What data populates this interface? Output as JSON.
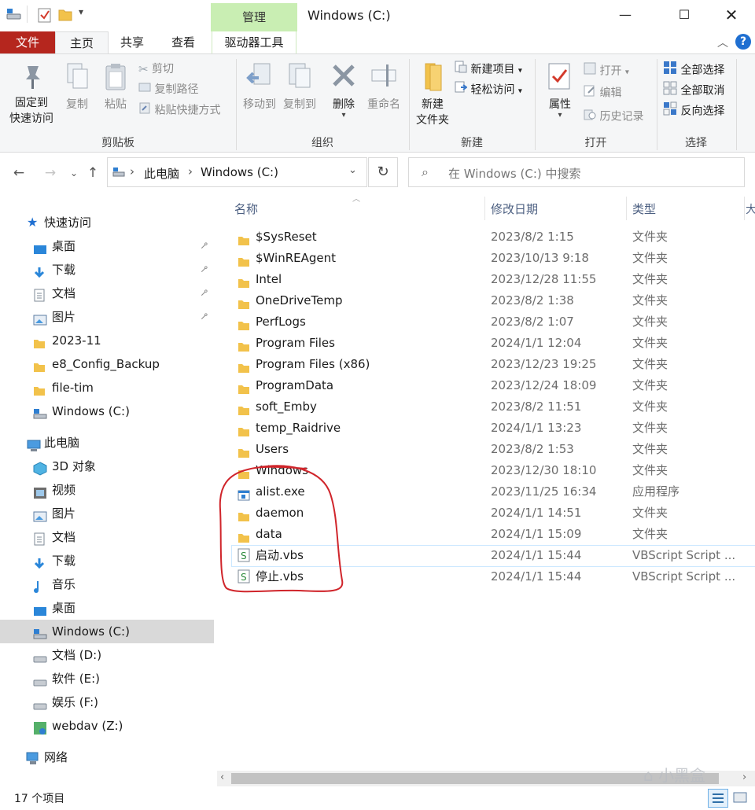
{
  "window": {
    "title": "Windows (C:)",
    "context_tab": "管理"
  },
  "tabs": [
    "文件",
    "主页",
    "共享",
    "查看",
    "驱动器工具"
  ],
  "ribbon": {
    "clipboard": {
      "pin": "固定到\n快速访问",
      "copy": "复制",
      "paste": "粘贴",
      "cut": "剪切",
      "copy_path": "复制路径",
      "paste_shortcut": "粘贴快捷方式",
      "label": "剪贴板"
    },
    "organize": {
      "move_to": "移动到",
      "copy_to": "复制到",
      "delete": "删除",
      "rename": "重命名",
      "label": "组织"
    },
    "new": {
      "new_folder": "新建\n文件夹",
      "new_item": "新建项目",
      "easy_access": "轻松访问",
      "label": "新建"
    },
    "open": {
      "properties": "属性",
      "open": "打开",
      "edit": "编辑",
      "history": "历史记录",
      "label": "打开"
    },
    "select": {
      "select_all": "全部选择",
      "select_none": "全部取消",
      "invert": "反向选择",
      "label": "选择"
    }
  },
  "address": {
    "crumbs": [
      "此电脑",
      "Windows (C:)"
    ],
    "search_placeholder": "在 Windows (C:) 中搜索"
  },
  "nav": {
    "quick_access": "快速访问",
    "quick_items": [
      {
        "label": "桌面",
        "pinned": true
      },
      {
        "label": "下载",
        "pinned": true
      },
      {
        "label": "文档",
        "pinned": true
      },
      {
        "label": "图片",
        "pinned": true
      },
      {
        "label": "2023-11",
        "pinned": false
      },
      {
        "label": "e8_Config_Backup",
        "pinned": false
      },
      {
        "label": "file-tim",
        "pinned": false
      },
      {
        "label": "Windows (C:)",
        "pinned": false
      }
    ],
    "this_pc": "此电脑",
    "pc_items": [
      "3D 对象",
      "视频",
      "图片",
      "文档",
      "下载",
      "音乐",
      "桌面",
      "Windows (C:)",
      "文档 (D:)",
      "软件 (E:)",
      "娱乐 (F:)",
      "webdav (Z:)"
    ],
    "network": "网络"
  },
  "columns": [
    "名称",
    "修改日期",
    "类型"
  ],
  "files": [
    {
      "name": "$SysReset",
      "date": "2023/8/2 1:15",
      "type": "文件夹",
      "icon": "folder"
    },
    {
      "name": "$WinREAgent",
      "date": "2023/10/13 9:18",
      "type": "文件夹",
      "icon": "folder"
    },
    {
      "name": "Intel",
      "date": "2023/12/28 11:55",
      "type": "文件夹",
      "icon": "folder"
    },
    {
      "name": "OneDriveTemp",
      "date": "2023/8/2 1:38",
      "type": "文件夹",
      "icon": "folder"
    },
    {
      "name": "PerfLogs",
      "date": "2023/8/2 1:07",
      "type": "文件夹",
      "icon": "folder"
    },
    {
      "name": "Program Files",
      "date": "2024/1/1 12:04",
      "type": "文件夹",
      "icon": "folder"
    },
    {
      "name": "Program Files (x86)",
      "date": "2023/12/23 19:25",
      "type": "文件夹",
      "icon": "folder"
    },
    {
      "name": "ProgramData",
      "date": "2023/12/24 18:09",
      "type": "文件夹",
      "icon": "folder"
    },
    {
      "name": "soft_Emby",
      "date": "2023/8/2 11:51",
      "type": "文件夹",
      "icon": "folder"
    },
    {
      "name": "temp_Raidrive",
      "date": "2024/1/1 13:23",
      "type": "文件夹",
      "icon": "folder"
    },
    {
      "name": "Users",
      "date": "2023/8/2 1:53",
      "type": "文件夹",
      "icon": "folder"
    },
    {
      "name": "Windows",
      "date": "2023/12/30 18:10",
      "type": "文件夹",
      "icon": "folder"
    },
    {
      "name": "alist.exe",
      "date": "2023/11/25 16:34",
      "type": "应用程序",
      "icon": "exe"
    },
    {
      "name": "daemon",
      "date": "2024/1/1 14:51",
      "type": "文件夹",
      "icon": "folder"
    },
    {
      "name": "data",
      "date": "2024/1/1 15:09",
      "type": "文件夹",
      "icon": "folder"
    },
    {
      "name": "启动.vbs",
      "date": "2024/1/1 15:44",
      "type": "VBScript Script ...",
      "icon": "vbs"
    },
    {
      "name": "停止.vbs",
      "date": "2024/1/1 15:44",
      "type": "VBScript Script ...",
      "icon": "vbs"
    }
  ],
  "status": {
    "count": "17 个项目"
  },
  "watermark": "小黑盒",
  "colors": {
    "file_tab": "#b5261e",
    "manage_tab": "#c9eeb3",
    "annotation": "#d0252b",
    "folder": "#f2c24b",
    "selected": "#d9d9d9"
  }
}
